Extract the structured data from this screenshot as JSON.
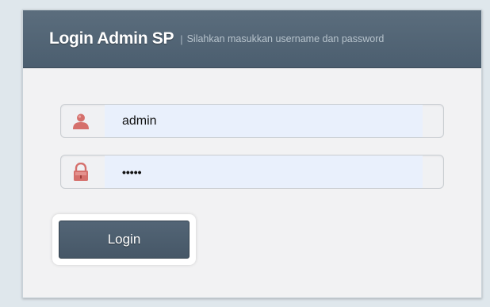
{
  "header": {
    "title": "Login Admin SP",
    "separator": "|",
    "subtitle": "Silahkan masukkan username dan password"
  },
  "form": {
    "username": {
      "icon": "user-icon",
      "value": "admin"
    },
    "password": {
      "icon": "lock-icon",
      "value": "•••••"
    },
    "submit_label": "Login"
  },
  "colors": {
    "header_bg": "#4f6273",
    "button_bg": "#4b5c6c",
    "icon_accent": "#d97a76",
    "input_fill": "#e9f0fc"
  }
}
